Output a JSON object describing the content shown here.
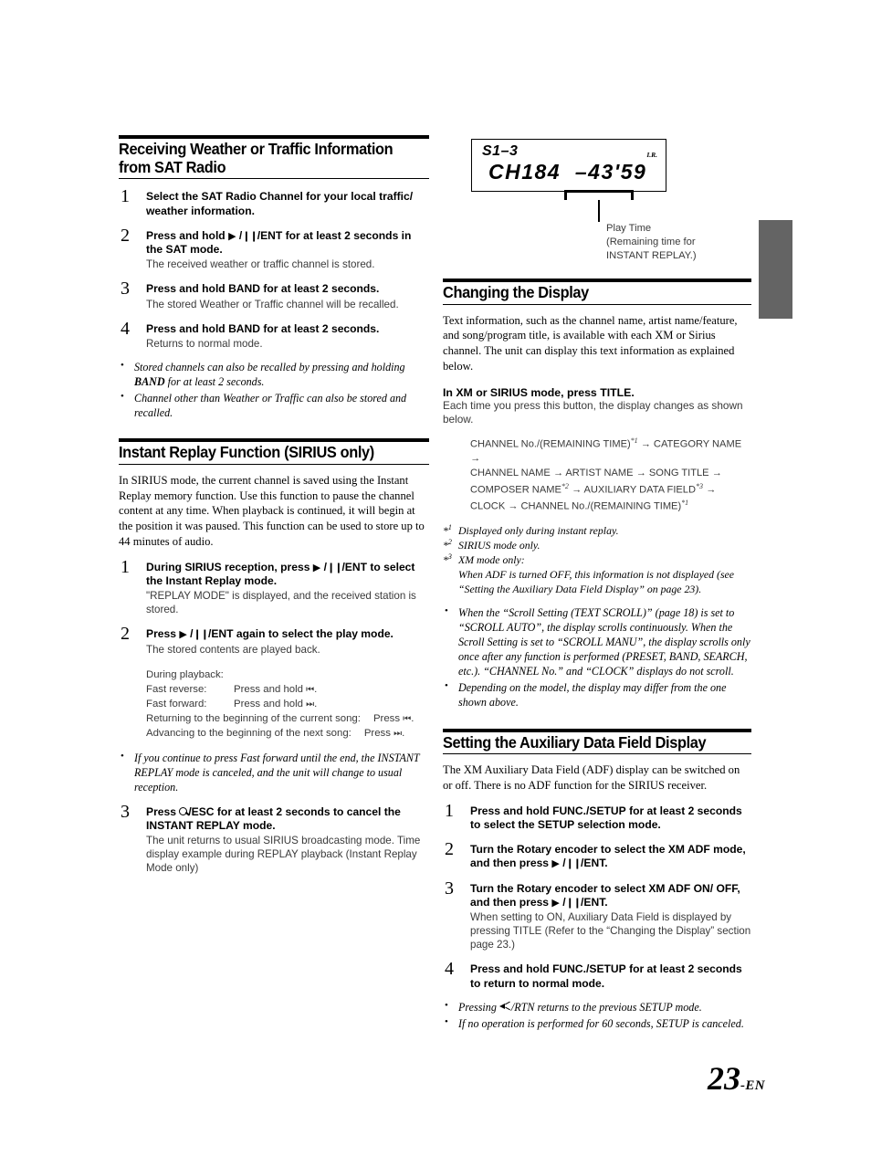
{
  "page": {
    "number": "23",
    "suffix": "-EN"
  },
  "left_column": {
    "section1": {
      "heading": "Receiving Weather or Traffic Information\nfrom SAT Radio",
      "steps": [
        {
          "num": "1",
          "title": "Select the SAT Radio Channel for your local traffic/ weather information.",
          "desc": ""
        },
        {
          "num": "2",
          "title_pre": "Press and hold ",
          "title_post": " for at least 2 seconds in the SAT mode.",
          "desc": "The received weather or traffic channel is stored."
        },
        {
          "num": "3",
          "title_pre": "Press and hold ",
          "key": "BAND",
          "title_post": " for at least 2 seconds.",
          "desc": "The stored Weather or Traffic channel will be recalled."
        },
        {
          "num": "4",
          "title_pre": "Press and hold ",
          "key": "BAND",
          "title_post": " for at least 2 seconds.",
          "desc": "Returns to normal mode."
        }
      ],
      "notes": [
        {
          "pre": "Stored channels can also be recalled by pressing and holding ",
          "bold": "BAND",
          "post": " for at least 2 seconds."
        },
        {
          "pre": "Channel other than Weather or Traffic can also be stored and recalled.",
          "bold": "",
          "post": ""
        }
      ]
    },
    "section2": {
      "heading": "Instant Replay Function (SIRIUS only)",
      "intro": "In SIRIUS mode, the current channel is saved using the Instant Replay memory function. Use this function to pause the channel content at any time. When playback is continued, it will begin at the position it was paused. This function can be used to store up to 44 minutes of audio.",
      "step1": {
        "num": "1",
        "title_pre": "During SIRIUS reception, press ",
        "title_post": " to select the Instant Replay mode.",
        "desc": "\"REPLAY MODE\" is displayed, and the received station is stored."
      },
      "step2": {
        "num": "2",
        "title_pre": "Press ",
        "title_post": " again to select the play mode.",
        "desc": "The stored contents are played back."
      },
      "playback": {
        "header": "During playback:",
        "rows": [
          {
            "label": "Fast reverse:",
            "action": "Press and hold",
            "icon": "rewind-icon",
            "end": "."
          },
          {
            "label": "Fast forward:",
            "action": "Press and hold",
            "icon": "fast-forward-icon",
            "end": "."
          },
          {
            "label": "Returning to the beginning of the current song:",
            "action": "Press",
            "icon": "rewind-icon",
            "end": "."
          },
          {
            "label": "Advancing to the beginning of the next song:",
            "action": "Press",
            "icon": "fast-forward-icon",
            "end": "."
          }
        ]
      },
      "note": "If you continue to press Fast forward until the end, the INSTANT REPLAY mode is canceled, and the unit will change to usual reception.",
      "step3": {
        "num": "3",
        "title_pre": "Press ",
        "key": "/ESC",
        "title_post": " for at least 2 seconds to cancel the INSTANT REPLAY mode.",
        "desc": "The unit returns to usual SIRIUS broadcasting mode. Time display example during REPLAY playback (Instant Replay Mode only)"
      }
    }
  },
  "figure": {
    "lcd": {
      "preset": "S1–3",
      "indicator": "I.R.",
      "main": "CH184  –43'59"
    },
    "callout": "Play Time\n(Remaining time for\nINSTANT REPLAY.)"
  },
  "right_column": {
    "section3": {
      "heading": "Changing the Display",
      "intro": "Text information, such as the channel name, artist name/feature, and song/program title, is available with each XM or Sirius channel. The unit can display this text information as explained below.",
      "subhead_pre": "In XM or SIRIUS mode, press ",
      "subhead_key": "TITLE",
      "subhead_post": ".",
      "sub_desc": "Each time you press this button, the display changes as shown below.",
      "flow_lines": [
        "CHANNEL No./(REMAINING TIME)*1 → CATEGORY NAME →",
        "CHANNEL NAME → ARTIST NAME → SONG TITLE →",
        "COMPOSER NAME*2 → AUXILIARY DATA FIELD*3 →",
        "CLOCK → CHANNEL No./(REMAINING TIME)*1"
      ],
      "footnotes": [
        {
          "mark": "*1",
          "text": "Displayed only during instant replay.",
          "indent": ""
        },
        {
          "mark": "*2",
          "text": "SIRIUS mode only.",
          "indent": ""
        },
        {
          "mark": "*3",
          "text": "XM mode only:",
          "indent": "When ADF is turned OFF, this information is not displayed (see “Setting the Auxiliary Data Field Display” on page 23)."
        }
      ],
      "notes": [
        "When the “Scroll Setting (TEXT SCROLL)” (page 18) is set to “SCROLL AUTO”, the display scrolls continuously. When the Scroll Setting is set to “SCROLL MANU”, the display scrolls only once after any function is performed (PRESET, BAND, SEARCH, etc.). “CHANNEL No.” and “CLOCK” displays do not scroll.",
        "Depending on the model, the display may differ from the one shown above."
      ]
    },
    "section4": {
      "heading": "Setting the Auxiliary Data Field Display",
      "intro": "The XM Auxiliary Data Field (ADF) display can be switched on or off. There is no ADF function for the SIRIUS receiver.",
      "steps": [
        {
          "num": "1",
          "title_pre": "Press and hold ",
          "key": "FUNC./SETUP",
          "title_post": " for at least 2 seconds to select the SETUP selection mode.",
          "desc": ""
        },
        {
          "num": "2",
          "title_pre": "Turn the ",
          "key": "Rotary encoder",
          "title_mid": " to select the XM ADF mode, and then press ",
          "title_post": ".",
          "desc": ""
        },
        {
          "num": "3",
          "title_pre": "Turn the ",
          "key": "Rotary encoder",
          "title_mid": " to select XM ADF ON/ OFF, and then press ",
          "title_post": ".",
          "desc": "When setting to ON, Auxiliary Data Field is displayed by pressing TITLE (Refer to the “Changing the Display” section page 23.)"
        },
        {
          "num": "4",
          "title_pre": "Press and hold ",
          "key": "FUNC./SETUP",
          "title_post": " for at least 2 seconds to  return to normal mode.",
          "desc": ""
        }
      ],
      "notes": [
        {
          "pre": "Pressing ",
          "icon": "mute-icon",
          "post": "/RTN returns to the previous SETUP mode."
        },
        {
          "pre": "If no operation is performed for 60 seconds, SETUP is canceled.",
          "icon": "",
          "post": ""
        }
      ]
    }
  }
}
